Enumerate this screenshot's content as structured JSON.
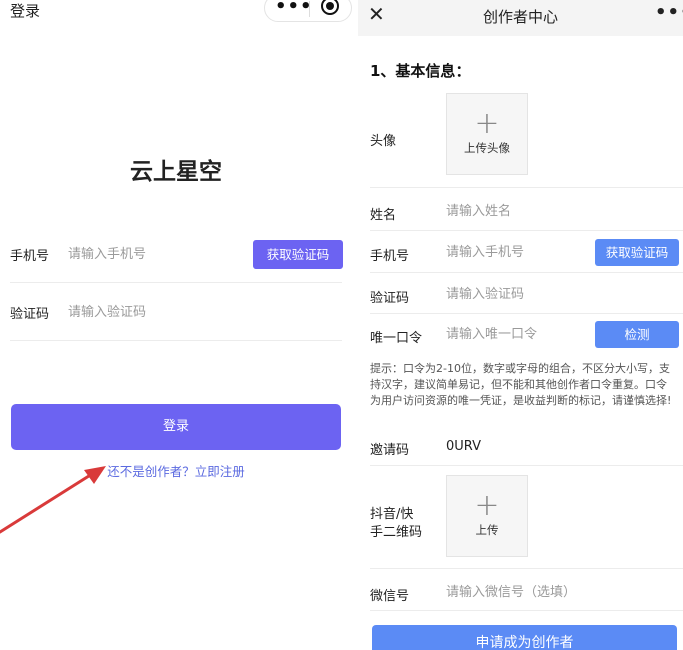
{
  "login": {
    "title": "登录",
    "app_name": "云上星空",
    "phone_label": "手机号",
    "phone_placeholder": "请输入手机号",
    "get_code_button": "获取验证码",
    "code_label": "验证码",
    "code_placeholder": "请输入验证码",
    "login_button": "登录",
    "register_link": "还不是创作者？立即注册",
    "capsule_more": "•••"
  },
  "creator": {
    "close": "✕",
    "title": "创作者中心",
    "more": "•••",
    "section_title": "1、基本信息：",
    "avatar_label": "头像",
    "avatar_upload": "上传头像",
    "plus": "+",
    "name_label": "姓名",
    "name_placeholder": "请输入姓名",
    "phone_label": "手机号",
    "phone_placeholder": "请输入手机号",
    "get_code_button": "获取验证码",
    "code_label": "验证码",
    "code_placeholder": "请输入验证码",
    "token_label": "唯一口令",
    "token_placeholder": "请输入唯一口令",
    "check_button": "检测",
    "hint": "提示：口令为2-10位，数字或字母的组合，不区分大小写，支持汉字，建议简单易记，但不能和其他创作者口令重复。口令为用户访问资源的唯一凭证，是收益判断的标记，请谨慎选择!",
    "invite_label": "邀请码",
    "invite_value": "0URV",
    "qrcode_label_line1": "抖音/快",
    "qrcode_label_line2": "手二维码",
    "qrcode_upload": "上传",
    "wechat_label": "微信号",
    "wechat_placeholder": "请输入微信号（选填）",
    "submit_button": "申请成为创作者"
  },
  "colors": {
    "login_accent": "#6c63f2",
    "creator_accent": "#5b8bf5",
    "link": "#5b6ae0",
    "arrow": "#d93a3a"
  }
}
